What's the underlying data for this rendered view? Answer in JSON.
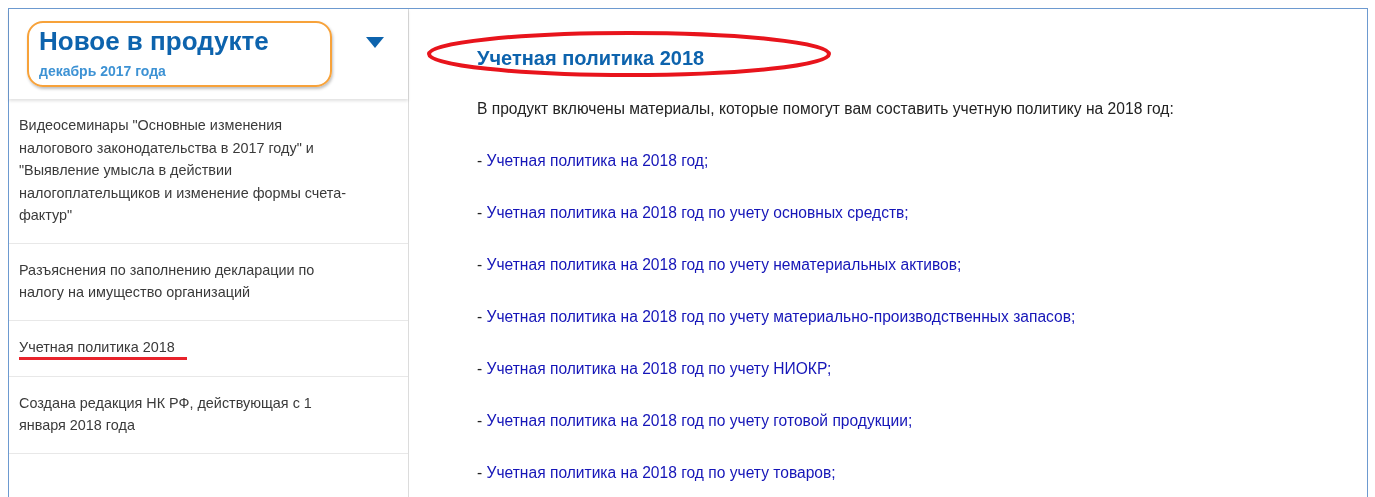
{
  "sidebar": {
    "title": "Новое в продукте",
    "subtitle": "декабрь 2017 года",
    "title_circled": true,
    "items": [
      {
        "text": "Видеосеминары \"Основные изменения налогового законодательства в 2017 году\" и \"Выявление умысла в действии налогоплательщиков и изменение формы счета-фактур\"",
        "underlined": false
      },
      {
        "text": "Разъяснения по заполнению декларации по налогу на имущество организаций",
        "underlined": false
      },
      {
        "text": "Учетная политика 2018",
        "underlined": true
      },
      {
        "text": "Создана редакция НК РФ, действующая с 1 января 2018 года",
        "underlined": false
      }
    ]
  },
  "article": {
    "title": "Учетная политика 2018",
    "title_circled": true,
    "intro": "В продукт включены материалы, которые помогут вам составить учетную политику на 2018 год:",
    "links": [
      {
        "marker": "-",
        "text": "Учетная политика на 2018 год;"
      },
      {
        "marker": "-",
        "text": "Учетная политика на 2018 год по учету основных средств;"
      },
      {
        "marker": "-",
        "text": "Учетная политика на 2018 год по учету нематериальных активов;"
      },
      {
        "marker": "-",
        "text": "Учетная политика на 2018 год по учету материально-производственных запасов;"
      },
      {
        "marker": "-",
        "text": "Учетная политика на 2018 год по учету НИОКР;"
      },
      {
        "marker": "-",
        "text": "Учетная политика на 2018 год по учету готовой продукции;"
      },
      {
        "marker": "-",
        "text": "Учетная политика на 2018 год по учету товаров;"
      }
    ]
  }
}
